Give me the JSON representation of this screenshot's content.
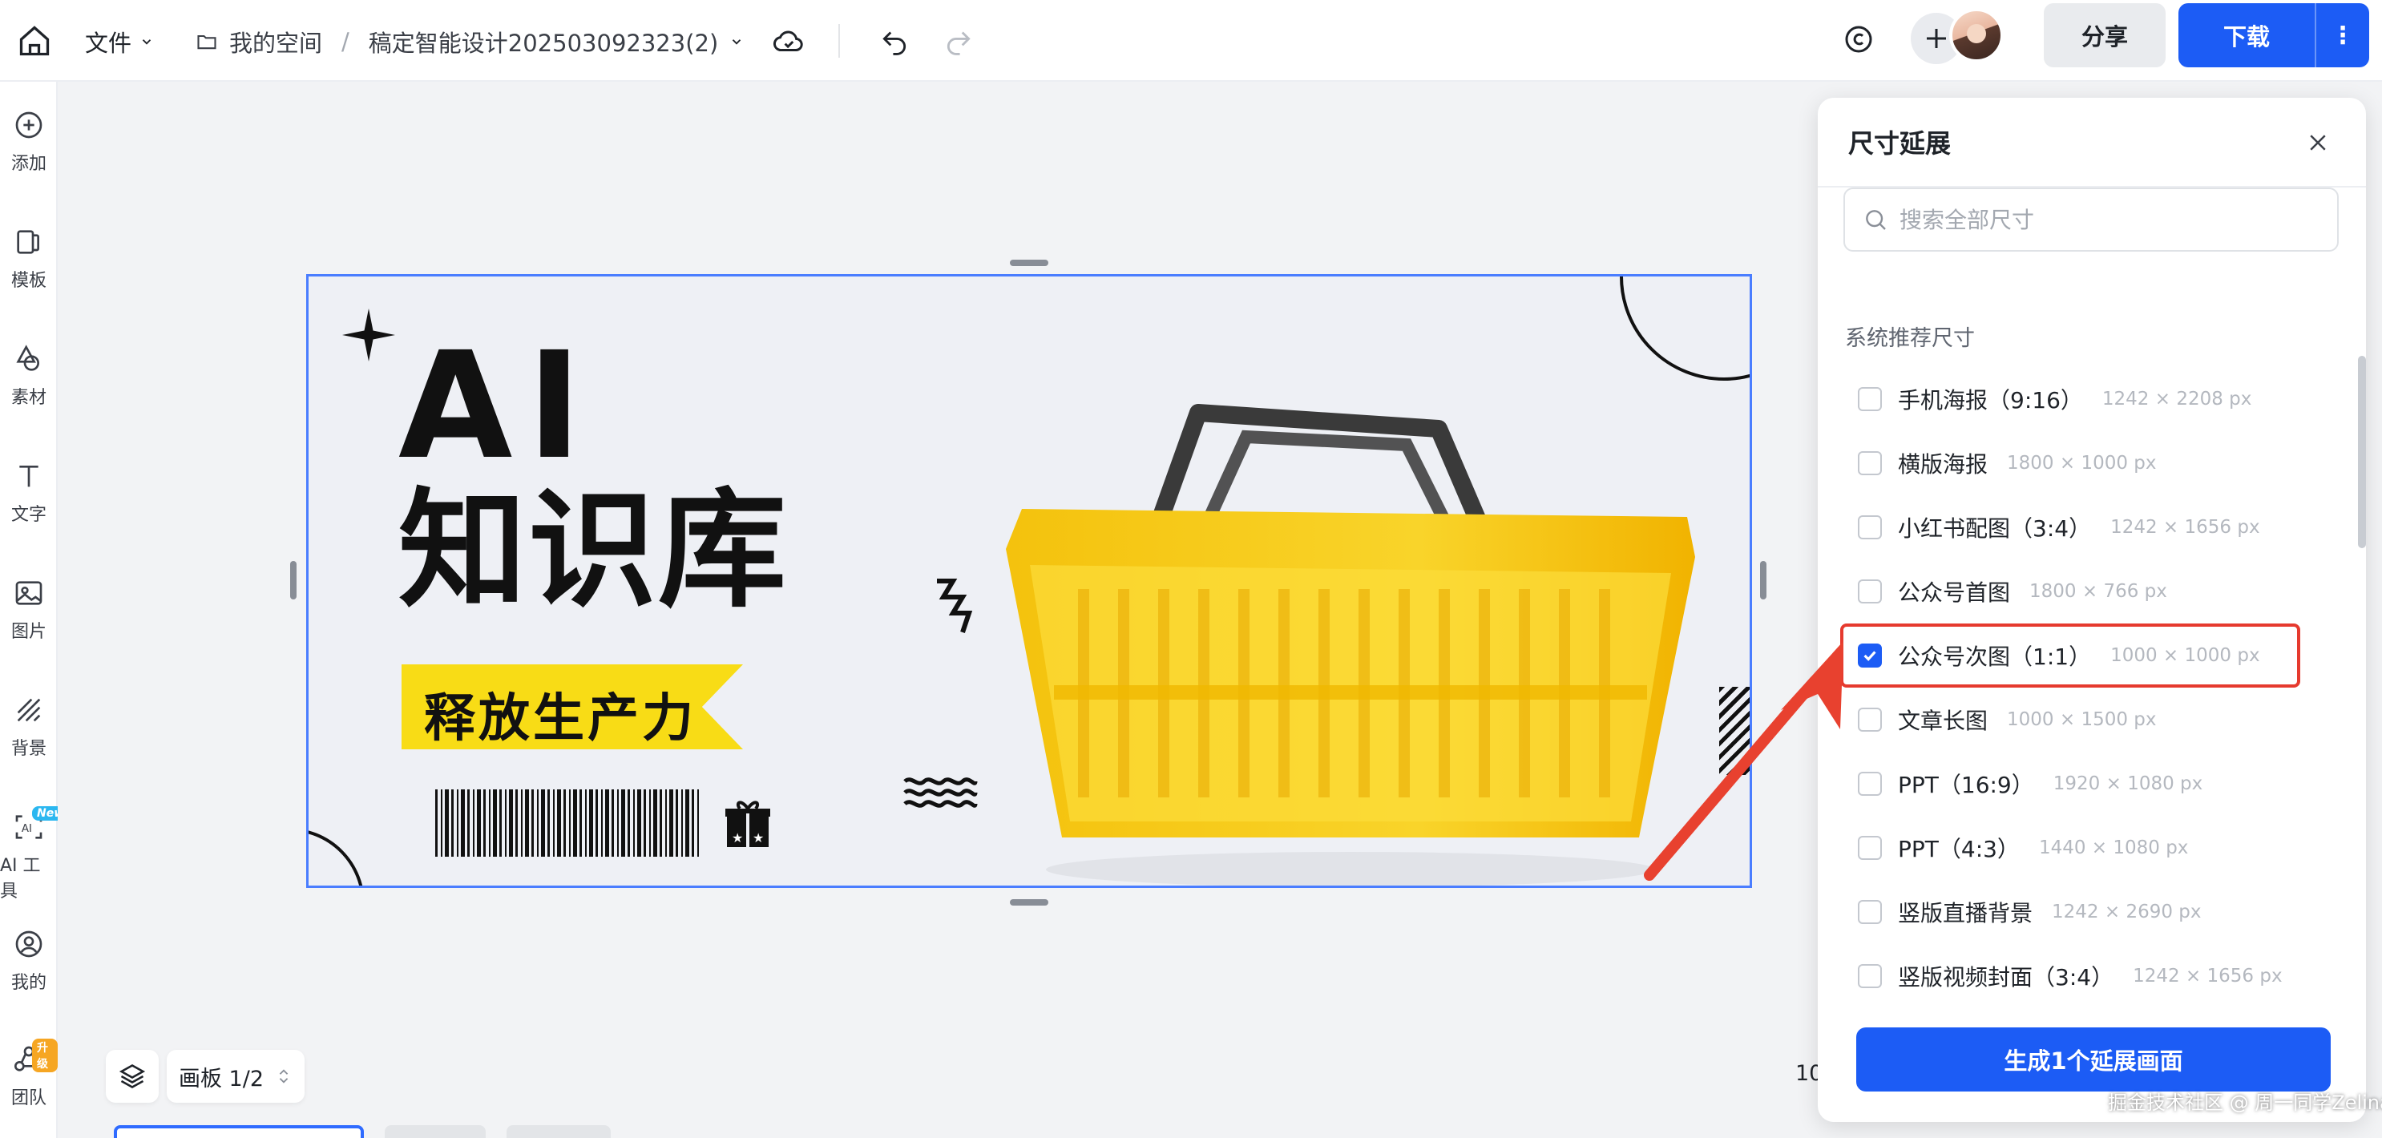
{
  "topbar": {
    "file_menu": "文件",
    "breadcrumb_space": "我的空间",
    "breadcrumb_separator": "/",
    "document_title": "稿定智能设计202503092323(2)",
    "share_label": "分享",
    "download_label": "下载"
  },
  "sidebar": {
    "items": [
      {
        "label": "添加",
        "icon": "plus-circle-icon"
      },
      {
        "label": "模板",
        "icon": "template-icon"
      },
      {
        "label": "素材",
        "icon": "shapes-icon"
      },
      {
        "label": "文字",
        "icon": "text-icon"
      },
      {
        "label": "图片",
        "icon": "image-icon"
      },
      {
        "label": "背景",
        "icon": "background-icon"
      },
      {
        "label": "AI 工具",
        "icon": "ai-tool-icon",
        "badge": "New"
      },
      {
        "label": "我的",
        "icon": "user-icon"
      },
      {
        "label": "团队",
        "icon": "team-icon",
        "badge": "升级"
      }
    ]
  },
  "artboard": {
    "headline_1": "AI",
    "headline_2": "知识库",
    "slogan": "释放生产力"
  },
  "canvas": {
    "page_indicator": "画板 1/2",
    "zoom_partial": "10"
  },
  "panel": {
    "title": "尺寸延展",
    "search_placeholder": "搜索全部尺寸",
    "section_label": "系统推荐尺寸",
    "sizes": [
      {
        "name": "手机海报（9:16）",
        "dims": "1242 × 2208 px",
        "checked": false
      },
      {
        "name": "横版海报",
        "dims": "1800 × 1000 px",
        "checked": false
      },
      {
        "name": "小红书配图（3:4）",
        "dims": "1242 × 1656 px",
        "checked": false
      },
      {
        "name": "公众号首图",
        "dims": "1800 × 766 px",
        "checked": false
      },
      {
        "name": "公众号次图（1:1）",
        "dims": "1000 × 1000 px",
        "checked": true
      },
      {
        "name": "文章长图",
        "dims": "1000 × 1500 px",
        "checked": false
      },
      {
        "name": "PPT（16:9）",
        "dims": "1920 × 1080 px",
        "checked": false
      },
      {
        "name": "PPT（4:3）",
        "dims": "1440 × 1080 px",
        "checked": false
      },
      {
        "name": "竖版直播背景",
        "dims": "1242 × 2690 px",
        "checked": false
      },
      {
        "name": "竖版视频封面（3:4）",
        "dims": "1242 × 1656 px",
        "checked": false
      }
    ],
    "generate_label": "生成1个延展画面"
  },
  "watermark": "掘金技术社区 @ 周一同学Zelina",
  "colors": {
    "primary": "#1c5cf5",
    "highlight": "#e63a2e",
    "slogan_bg": "#f8dc16",
    "basket": "#f7c51e"
  }
}
